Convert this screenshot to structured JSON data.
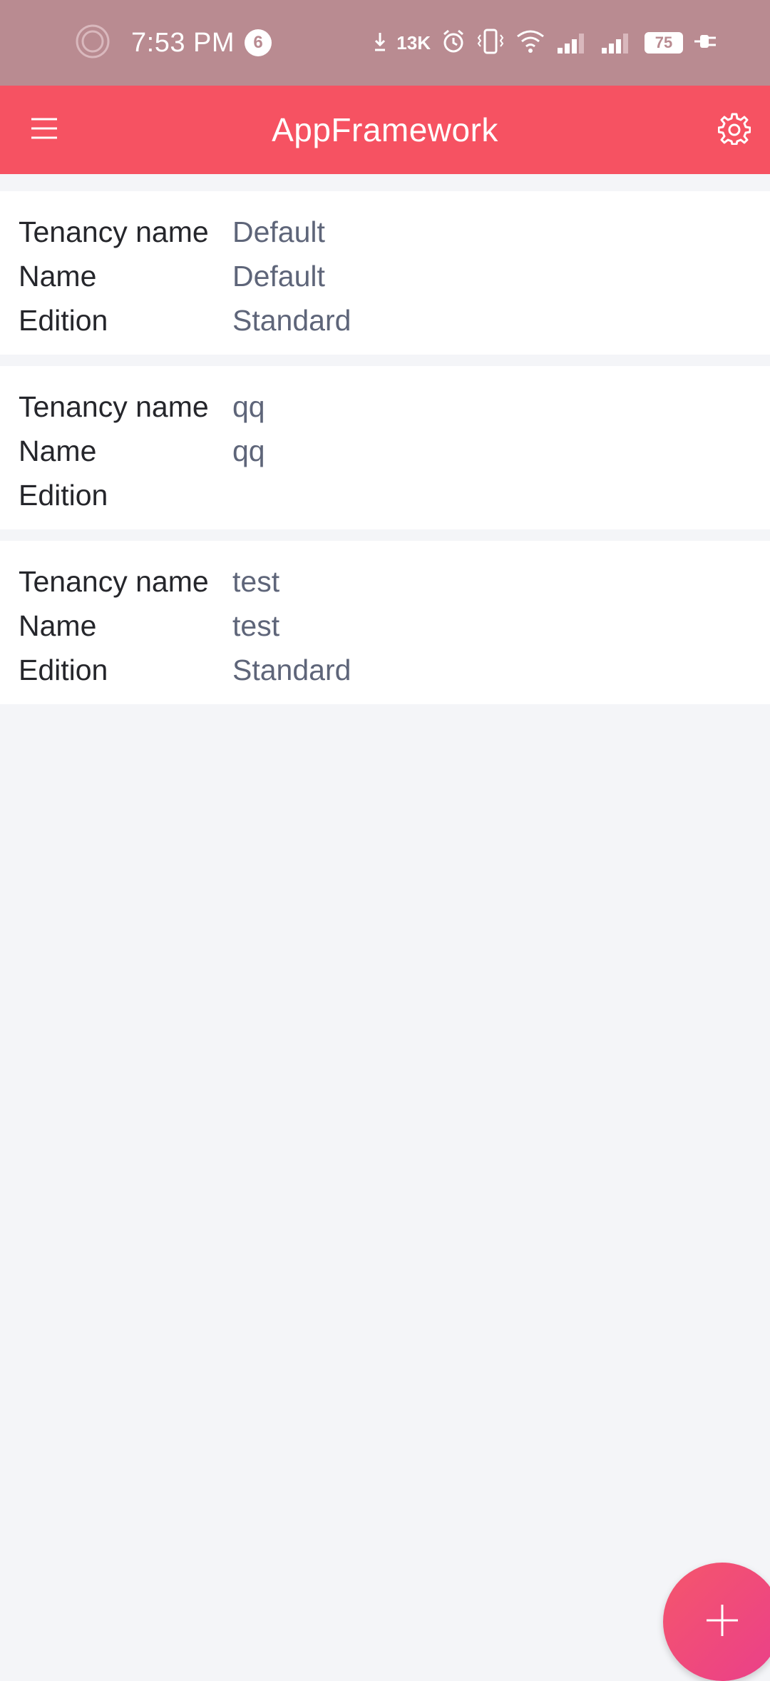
{
  "status_bar": {
    "time": "7:53 PM",
    "notification_count": "6",
    "net_speed": "13K",
    "battery_level": "75",
    "background_color": "#b98b91"
  },
  "header": {
    "title": "AppFramework",
    "background_color": "#f65262",
    "menu_icon": "hamburger-menu-icon",
    "settings_icon": "gear-icon"
  },
  "tenants": [
    {
      "tenancy_name_label": "Tenancy name",
      "tenancy_name": "Default",
      "name_label": "Name",
      "name": "Default",
      "edition_label": "Edition",
      "edition": "Standard"
    },
    {
      "tenancy_name_label": "Tenancy name",
      "tenancy_name": "qq",
      "name_label": "Name",
      "name": "qq",
      "edition_label": "Edition",
      "edition": ""
    },
    {
      "tenancy_name_label": "Tenancy name",
      "tenancy_name": "test",
      "name_label": "Name",
      "name": "test",
      "edition_label": "Edition",
      "edition": "Standard"
    }
  ],
  "fab": {
    "icon": "plus-icon",
    "accent_color": "#ee4880"
  }
}
